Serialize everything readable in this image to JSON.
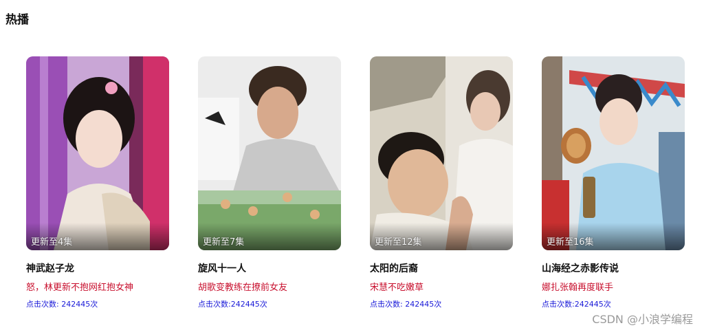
{
  "section": {
    "title": "热播"
  },
  "shows": [
    {
      "title": "神武赵子龙",
      "update": "更新至4集",
      "desc": "怒，林更新不抱网红抱女神",
      "clicks": "点击次数: 242445次"
    },
    {
      "title": "旋风十一人",
      "update": "更新至7集",
      "desc": "胡歌变教练在撩前女友",
      "clicks": "点击次数:242445次"
    },
    {
      "title": "太阳的后裔",
      "update": "更新至12集",
      "desc": "宋慧不吃嫩草",
      "clicks": "点击次数: 242445次"
    },
    {
      "title": "山海经之赤影传说",
      "update": "更新至16集",
      "desc": "娜扎张翰再度联手",
      "clicks": "点击次数:242445次"
    }
  ],
  "watermark": "CSDN @小浪学编程",
  "colors": {
    "desc_red": "#c8102e",
    "clicks_blue": "#1a1ad8"
  }
}
